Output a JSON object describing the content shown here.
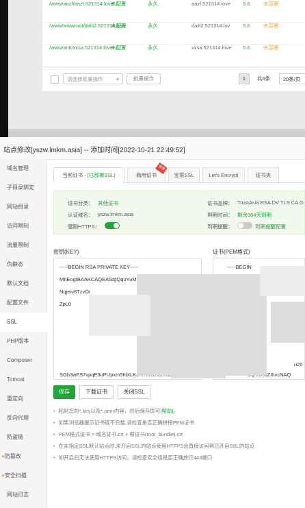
{
  "background_table": {
    "rows": [
      {
        "path": "/www/aazf/aazf.521314.love",
        "status": "未配置",
        "period": "永久",
        "domain": "aazf.521314.love",
        "php": "5.6",
        "ssl": "未部署"
      },
      {
        "path": "/www/wwwroot/daili2.521314.love",
        "status": "未配置",
        "period": "永久",
        "domain": "daili2.521314.lov",
        "php": "5.6",
        "ssl": "未部署"
      },
      {
        "path": "/www/anlt/xxsa.521314.love",
        "status": "未配置",
        "period": "永久",
        "domain": "xxsa.521314.love",
        "php": "5.6",
        "ssl": "未部署"
      }
    ],
    "batch_select_placeholder": "请选择批量操作",
    "batch_button": "批量操作",
    "page_current": "1",
    "total": "共6条",
    "per_page": "20条/页"
  },
  "modal": {
    "title": "站点修改[yszw.lmkm.asia] -- 添加时间[2022-10-21 22:49:52]",
    "sidebar": [
      {
        "label": "域名管理",
        "mark": ""
      },
      {
        "label": "子目录绑定",
        "mark": ""
      },
      {
        "label": "网站目录",
        "mark": ""
      },
      {
        "label": "访问限制",
        "mark": ""
      },
      {
        "label": "流量限制",
        "mark": ""
      },
      {
        "label": "伪静态",
        "mark": ""
      },
      {
        "label": "默认文档",
        "mark": ""
      },
      {
        "label": "配置文件",
        "mark": ""
      },
      {
        "label": "SSL",
        "mark": ""
      },
      {
        "label": "PHP版本",
        "mark": ""
      },
      {
        "label": "Composer",
        "mark": ""
      },
      {
        "label": "Tomcat",
        "mark": ""
      },
      {
        "label": "重定向",
        "mark": ""
      },
      {
        "label": "反向代理",
        "mark": ""
      },
      {
        "label": "防盗链",
        "mark": ""
      },
      {
        "label": "防篡改",
        "mark": "●"
      },
      {
        "label": "安全扫描",
        "mark": "●"
      },
      {
        "label": "网站日志",
        "mark": ""
      }
    ],
    "tabs": {
      "current_cert_prefix": "当前证书 - ",
      "current_cert_status": "[已部署SSL]",
      "commercial": "商用证书",
      "commercial_ribbon": "推荐",
      "baota": "宝塔SSL",
      "letsencrypt": "Let's Encrypt",
      "cert_folder": "证书夹"
    },
    "cert_info": {
      "category_label": "证书分类：",
      "category_value": "其他证书",
      "domain_label": "认证域名：",
      "domain_value": "yszw.lmkm.asia",
      "https_label": "强制HTTPS：",
      "brand_label": "证书品牌：",
      "brand_value": "TrustAsia RSA DV TLS CA G",
      "expire_label": "到期时间：",
      "expire_value": "剩余364天到期",
      "remind_label": "到期提醒：",
      "remind_value": "到期提醒配置"
    },
    "key_label": "密钥(KEY)",
    "pem_label": "证书(PEM格式)",
    "key_lines": [
      "-----BEGIN RSA PRIVATE KEY-----",
      "MIIEogIBAAKCAQEAStgQquYuMVor3nnDeKZB",
      "Nqjeiv8TzvOr",
      "ZpL0"
    ],
    "key_last_line": "SGb3wFS7vpqE3uPUpxm5hbILKJFi4hHw6wWzRGCIp",
    "pem_lines": [
      "-----BEGIN"
    ],
    "pem_last_line": "SQYJKoZIhvcNAQ",
    "pem_tail": "u20",
    "buttons": {
      "save": "保存",
      "download": "下载证书",
      "close_ssl": "关闭SSL"
    },
    "tips": [
      {
        "text": "粘贴您的*.key以及*.pem内容，然后保存即可",
        "link": "[帮助]",
        "tail": "。"
      },
      {
        "text": "如果浏览器提示证书链不完整,请检查是否正确拼接PEM证书",
        "link": "",
        "tail": ""
      },
      {
        "text": "PEM格式证书 = 域名证书.crt + 根证书(root_bundle).crt",
        "link": "",
        "tail": ""
      },
      {
        "text": "在未指定SSL默认站点时,未开启SSL的站点使用HTTPS会直接访问到已开启SSL的站点",
        "link": "",
        "tail": ""
      },
      {
        "text": "如开启后无法使用HTTPS访问，请检查安全组是否正确放行443端口",
        "link": "",
        "tail": ""
      }
    ]
  },
  "colors": {
    "accent": "#20a53a",
    "warning": "#f0ad4e",
    "ribbon": "#e3463d"
  }
}
